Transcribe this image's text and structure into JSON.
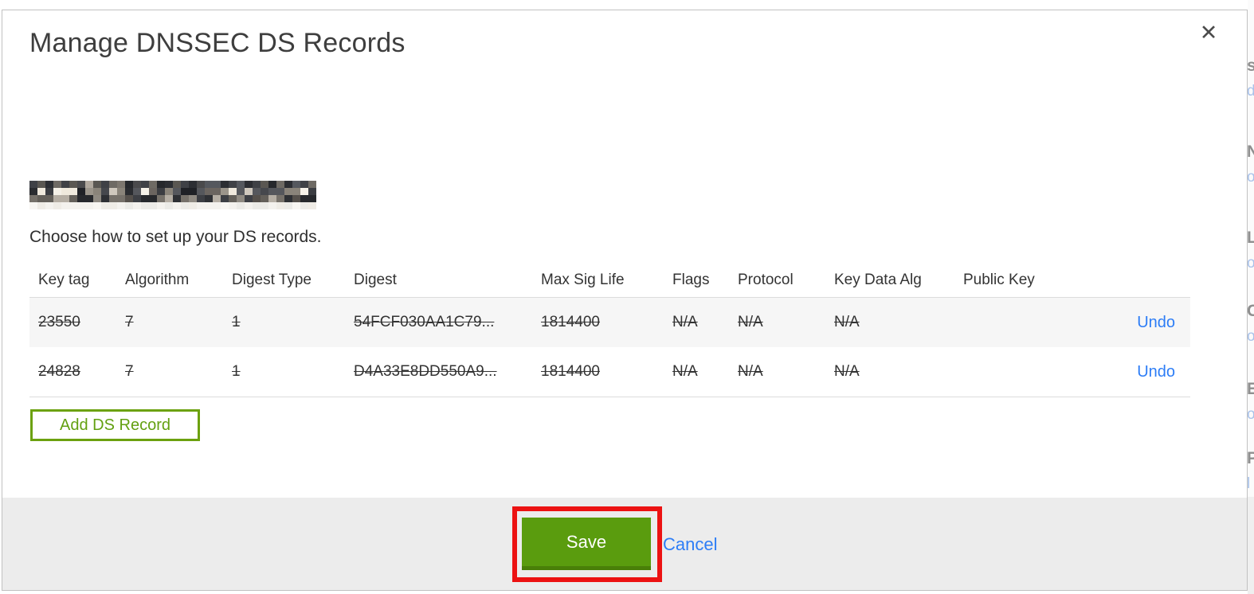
{
  "modal": {
    "title": "Manage DNSSEC DS Records",
    "close_icon": "✕",
    "instruction": "Choose how to set up your DS records.",
    "domain_redacted": true,
    "table": {
      "columns": [
        "Key tag",
        "Algorithm",
        "Digest Type",
        "Digest",
        "Max Sig Life",
        "Flags",
        "Protocol",
        "Key Data Alg",
        "Public Key"
      ],
      "rows": [
        {
          "key_tag": "23550",
          "algorithm": "7",
          "digest_type": "1",
          "digest": "54FCF030AA1C79...",
          "max_sig_life": "1814400",
          "flags": "N/A",
          "protocol": "N/A",
          "key_data_alg": "N/A",
          "public_key": "",
          "action": "Undo",
          "marked_for_deletion": true
        },
        {
          "key_tag": "24828",
          "algorithm": "7",
          "digest_type": "1",
          "digest": "D4A33E8DD550A9...",
          "max_sig_life": "1814400",
          "flags": "N/A",
          "protocol": "N/A",
          "key_data_alg": "N/A",
          "public_key": "",
          "action": "Undo",
          "marked_for_deletion": true
        }
      ]
    },
    "add_button_label": "Add DS Record",
    "footer": {
      "save_label": "Save",
      "cancel_label": "Cancel"
    }
  },
  "colors": {
    "accent_green": "#5a9c0e",
    "green_dark": "#497f08",
    "outline_green": "#6ca10f",
    "link_blue": "#2d7df6",
    "annotation_red": "#ec1212",
    "footer_gray": "#ececec",
    "row_stripe_gray": "#f6f6f6",
    "text_dark": "#333333"
  },
  "redaction": {
    "cols": 36,
    "row_palettes": [
      [
        "#4a4a4c",
        "#2c2e33",
        "#6e6a64",
        "#8d8781",
        "#3f4146",
        "#5a5752",
        "#26282c",
        "#7d776f",
        "#b0a89e",
        "#55585e"
      ],
      [
        "#1f2126",
        "#3b3d42",
        "#8a847a",
        "#efe9dd",
        "#55575c",
        "#cfc8bd",
        "#2a2c30",
        "#6b6560",
        "#f5f1e8",
        "#46484d",
        "#9b958b"
      ],
      [
        "#2e3034",
        "#55504b",
        "#76716a",
        "#3d3f44",
        "#8f8a82",
        "#26282c",
        "#64605a",
        "#b5aea4"
      ],
      [
        "#f4f2ee",
        "#ecebe7",
        "#f8f6f2",
        "#efece6"
      ]
    ]
  },
  "background_page_fragments": [
    {
      "heading_letter": "s",
      "link_letter": "d"
    },
    {
      "heading_letter": "N",
      "link_letter": "o"
    },
    {
      "heading_letter": "L",
      "link_letter": "o"
    },
    {
      "heading_letter": "C",
      "link_letter": "o"
    },
    {
      "heading_letter": "E",
      "link_letter": "o"
    },
    {
      "heading_letter": "P",
      "link_letter": "l"
    }
  ]
}
